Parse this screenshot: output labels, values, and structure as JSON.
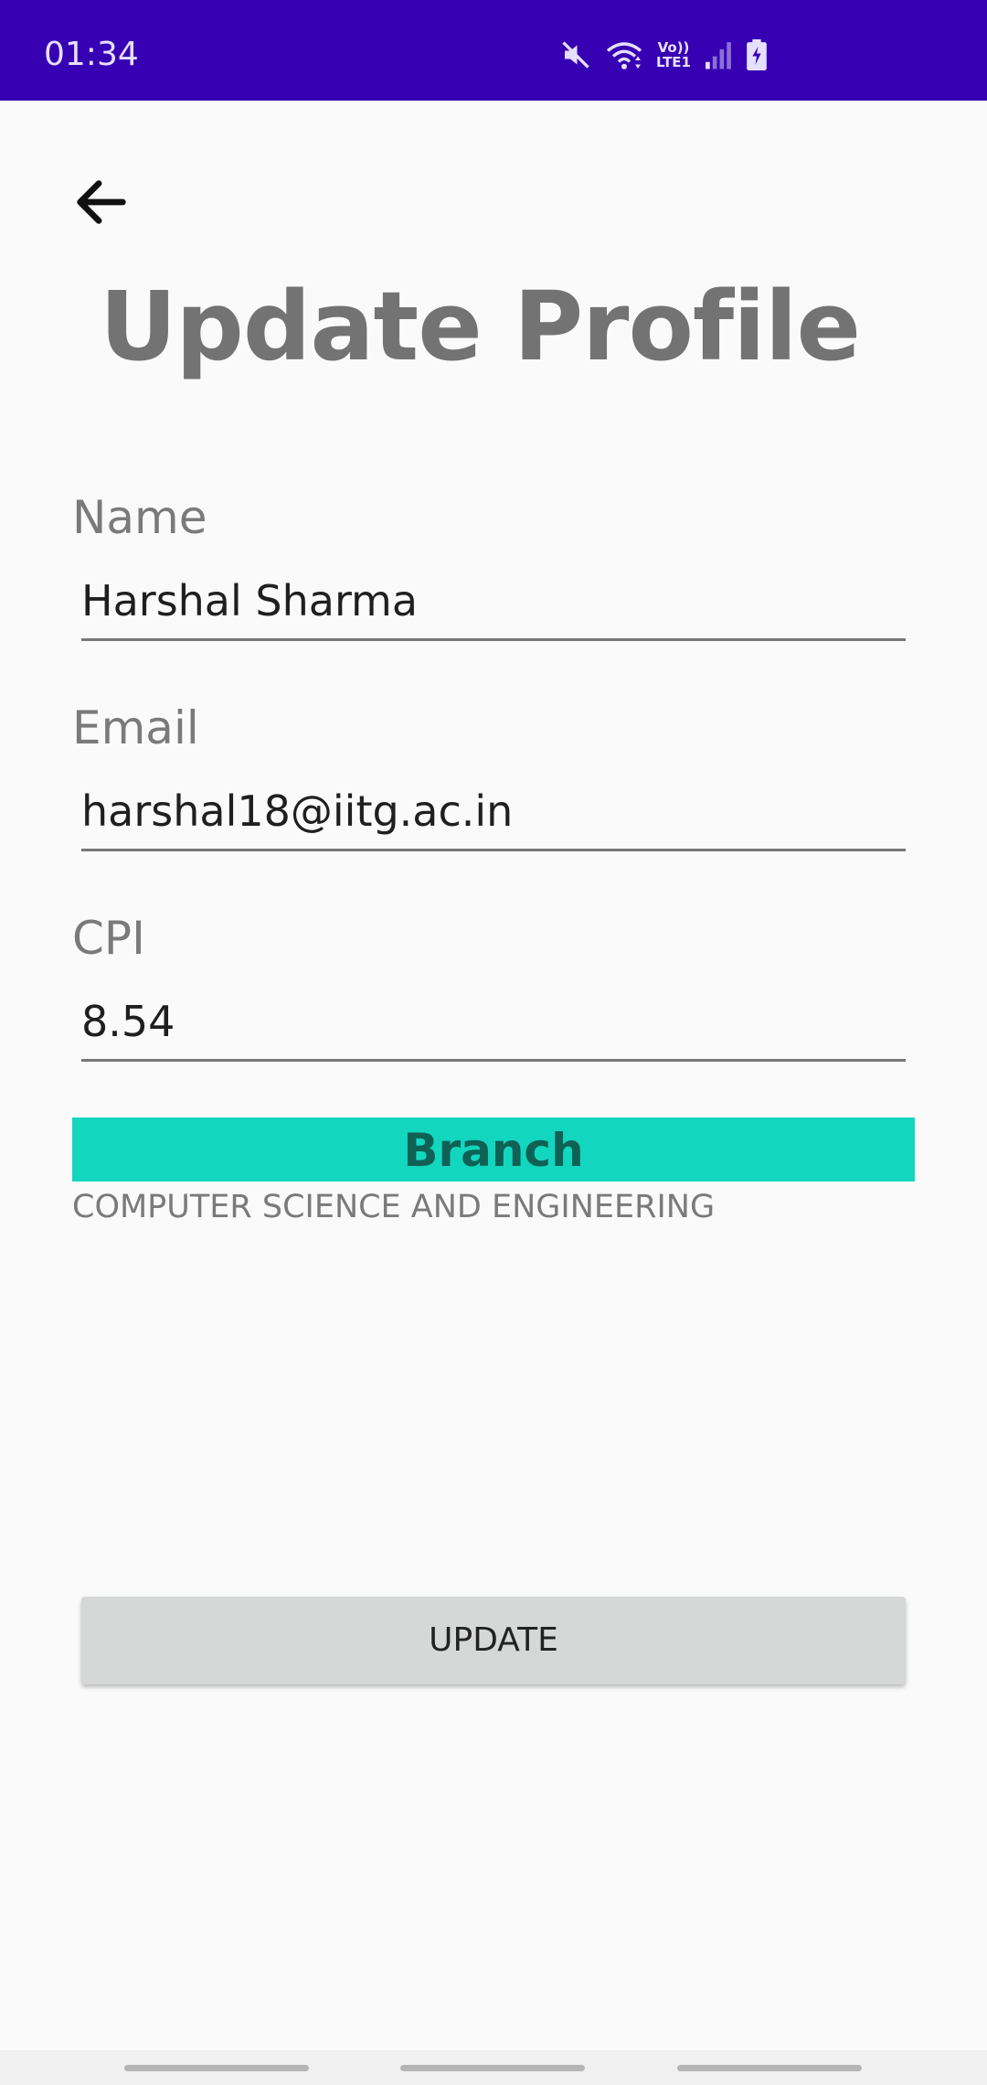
{
  "status_bar": {
    "time": "01:34",
    "network_label_top": "Vo))",
    "network_label_bottom": "LTE1",
    "icons": [
      "mute-icon",
      "wifi-icon",
      "lte-icon",
      "signal-icon",
      "battery-charging-icon"
    ]
  },
  "header": {
    "back_icon": "arrow-left-icon",
    "title": "Update Profile"
  },
  "form": {
    "name_label": "Name",
    "name_value": "Harshal Sharma",
    "email_label": "Email",
    "email_value": "harshal18@iitg.ac.in",
    "cpi_label": "CPI",
    "cpi_value": "8.54",
    "branch_label": "Branch",
    "branch_value": "COMPUTER SCIENCE AND ENGINEERING"
  },
  "actions": {
    "update_label": "UPDATE"
  },
  "colors": {
    "status_bar": "#3700b3",
    "branch_bar": "#13d6be",
    "branch_text": "#0f6156",
    "background": "#fafafa",
    "button": "#d6d7d7"
  }
}
